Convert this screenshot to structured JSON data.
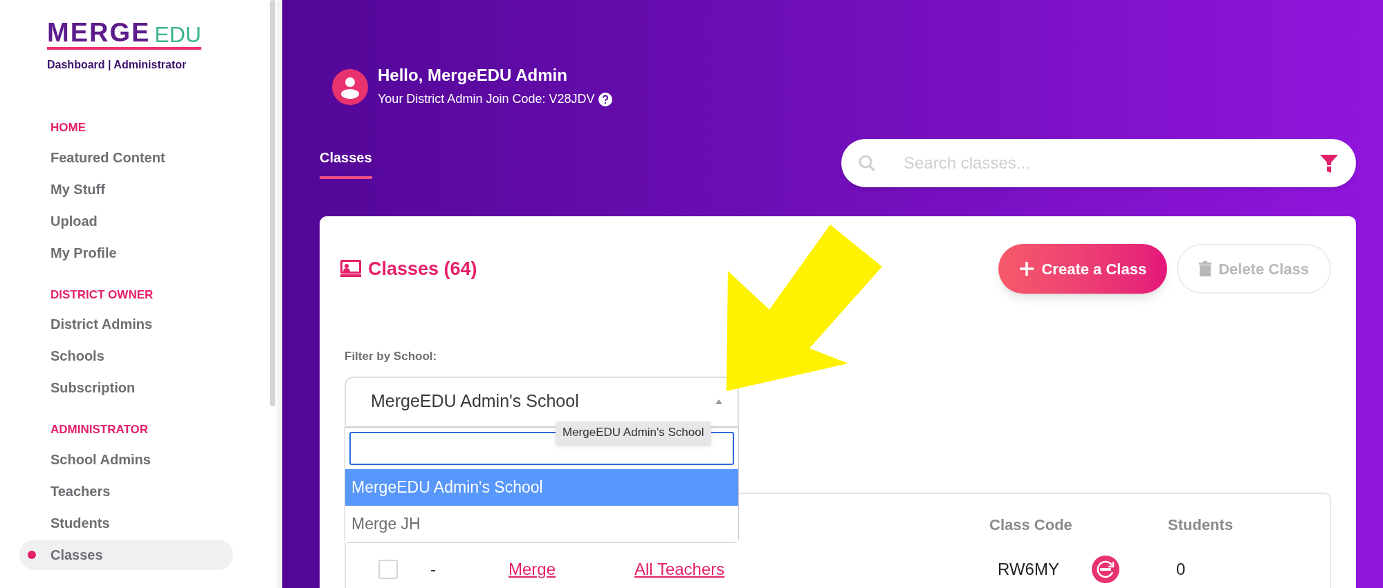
{
  "logo": {
    "wordmark": "MERGE",
    "suffix": "EDU",
    "subtitle": "Dashboard | Administrator"
  },
  "sidebar": {
    "sections": [
      {
        "heading": "HOME",
        "items": [
          {
            "label": "Featured Content",
            "selected": false
          },
          {
            "label": "My Stuff",
            "selected": false
          },
          {
            "label": "Upload",
            "selected": false
          },
          {
            "label": "My Profile",
            "selected": false
          }
        ]
      },
      {
        "heading": "DISTRICT OWNER",
        "items": [
          {
            "label": "District Admins",
            "selected": false
          },
          {
            "label": "Schools",
            "selected": false
          },
          {
            "label": "Subscription",
            "selected": false
          }
        ]
      },
      {
        "heading": "ADMINISTRATOR",
        "items": [
          {
            "label": "School Admins",
            "selected": false
          },
          {
            "label": "Teachers",
            "selected": false
          },
          {
            "label": "Students",
            "selected": false
          },
          {
            "label": "Classes",
            "selected": true
          }
        ]
      }
    ]
  },
  "header": {
    "greeting": "Hello, MergeEDU Admin",
    "join_code": "Your District Admin Join Code: V28JDV"
  },
  "tabs": [
    {
      "label": "Classes",
      "selected": true
    }
  ],
  "search": {
    "placeholder": "Search classes..."
  },
  "card": {
    "title": "Classes (64)",
    "buttons": [
      {
        "kind": "create",
        "label": "Create a Class",
        "disabled": false
      },
      {
        "kind": "delete",
        "label": "Delete Class",
        "disabled": true
      }
    ],
    "filter": {
      "label": "Filter by School:",
      "value": "MergeEDU Admin's School",
      "expanded": true,
      "options": [
        {
          "label": "MergeEDU Admin's School",
          "selected": true
        },
        {
          "label": "Merge JH",
          "selected": false
        }
      ],
      "tooltip": "MergeEDU Admin's School"
    },
    "table": {
      "headers": {
        "class_code": "Class Code",
        "students": "Students"
      },
      "rows": [
        {
          "checked": false,
          "column_1": "-",
          "column_2": "Merge",
          "column_3": "All Teachers",
          "class_code": "RW6MY",
          "students": "0"
        }
      ]
    }
  }
}
